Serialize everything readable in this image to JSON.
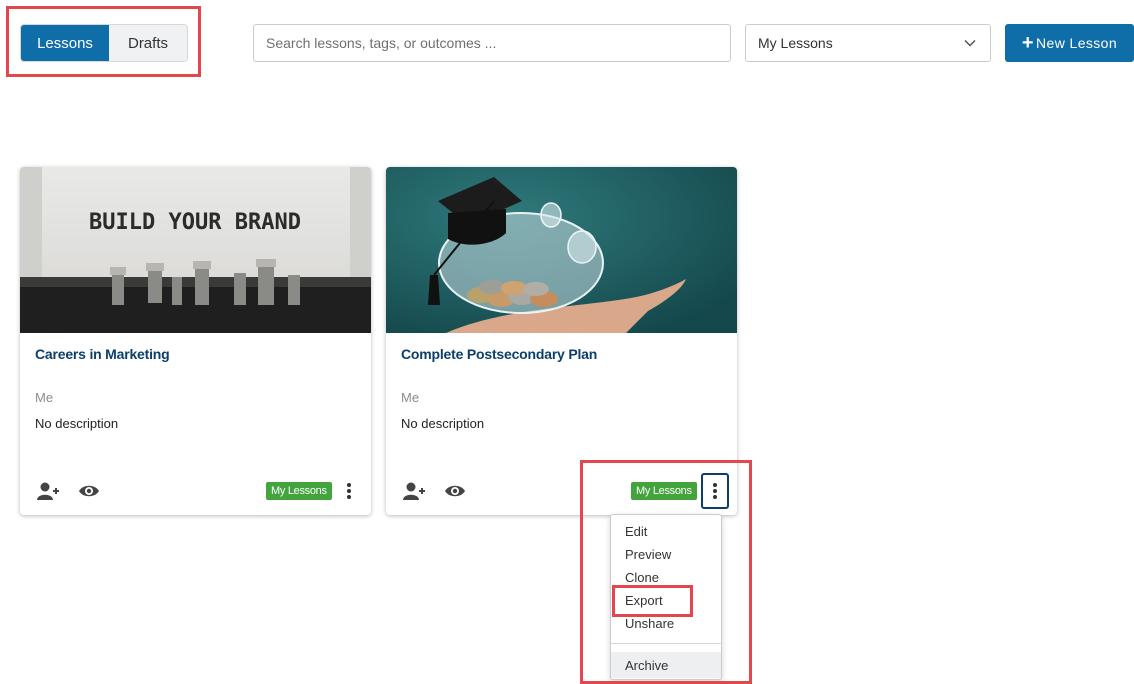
{
  "toolbar": {
    "tabs": [
      {
        "label": "Lessons",
        "active": true
      },
      {
        "label": "Drafts",
        "active": false
      }
    ],
    "search_placeholder": "Search lessons, tags, or outcomes ...",
    "filter_selected": "My Lessons",
    "new_button_plus": "+",
    "new_button_label": "New Lesson"
  },
  "cards": [
    {
      "image_text": "BUILD YOUR BRAND",
      "title": "Careers in Marketing",
      "author": "Me",
      "description": "No description",
      "badge": "My Lessons"
    },
    {
      "title": "Complete Postsecondary Plan",
      "author": "Me",
      "description": "No description",
      "badge": "My Lessons"
    }
  ],
  "menu": {
    "items": [
      "Edit",
      "Preview",
      "Clone",
      "Export",
      "Unshare"
    ],
    "archive": "Archive"
  },
  "colors": {
    "primary": "#0f6da8",
    "title": "#0b3f6b",
    "badge": "#43a33d",
    "highlight": "#e2474b"
  },
  "icons": {
    "share": "person-plus-icon",
    "preview": "eye-icon",
    "menu": "kebab-icon",
    "dropdown": "chevron-down-icon"
  }
}
